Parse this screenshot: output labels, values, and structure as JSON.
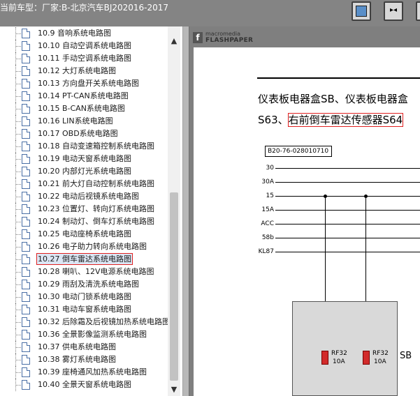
{
  "header": {
    "title": "当前车型：厂家:B-北京汽车BJ202016-2017",
    "buttons": [
      {
        "name": "toggle-panel",
        "glyph": "▪"
      },
      {
        "name": "fit-width",
        "glyph": "▸◂"
      },
      {
        "name": "fit-page",
        "glyph": "◂▸"
      }
    ]
  },
  "tree": {
    "items": [
      {
        "label": "10.9 音响系统电路图"
      },
      {
        "label": "10.10 自动空调系统电路图"
      },
      {
        "label": "10.11 手动空调系统电路图"
      },
      {
        "label": "10.12 大灯系统电路图"
      },
      {
        "label": "10.13 方向盘开关系统电路图"
      },
      {
        "label": "10.14 PT-CAN系统电路图"
      },
      {
        "label": "10.15 B-CAN系统电路图"
      },
      {
        "label": "10.16 LIN系统电路图"
      },
      {
        "label": "10.17 OBD系统电路图"
      },
      {
        "label": "10.18 自动变速箱控制系统电路图"
      },
      {
        "label": "10.19 电动天窗系统电路图"
      },
      {
        "label": "10.20 内部灯光系统电路图"
      },
      {
        "label": "10.21 前大灯自动控制系统电路图"
      },
      {
        "label": "10.22 电动后视镜系统电路图"
      },
      {
        "label": "10.23 位置灯、转向灯系统电路图"
      },
      {
        "label": "10.24 制动灯、倒车灯系统电路图"
      },
      {
        "label": "10.25 电动座椅系统电路图"
      },
      {
        "label": "10.26 电子助力转向系统电路图"
      },
      {
        "label": "10.27 倒车雷达系统电路图",
        "selected": true
      },
      {
        "label": "10.28 喇叭、12V电源系统电路图"
      },
      {
        "label": "10.29 雨刮及清洗系统电路图"
      },
      {
        "label": "10.30 电动门锁系统电路图"
      },
      {
        "label": "10.31 电动车窗系统电路图"
      },
      {
        "label": "10.32 后除霜及后视镜加热系统电路图"
      },
      {
        "label": "10.36 全景影像监测系统电路图"
      },
      {
        "label": "10.37 供电系统电路图"
      },
      {
        "label": "10.38 雾灯系统电路图"
      },
      {
        "label": "10.39 座椅通风加热系统电路图"
      },
      {
        "label": "10.40 全景天窗系统电路图"
      }
    ]
  },
  "viewer": {
    "logo_small": "macromedia",
    "logo_big": "FLASHPAPER",
    "heading_line1": "仪表板电器盒SB、仪表板电器盒",
    "heading_line2_prefix": "S63、",
    "heading_line2_boxed": "右前倒车雷达传感器S64",
    "code": "B20-76-028010710",
    "bus_labels": [
      "30",
      "30A",
      "15",
      "15A",
      "ACC",
      "58b",
      "KL87"
    ],
    "fuses": [
      {
        "label": "RF32",
        "rating": "10A"
      },
      {
        "label": "RF32",
        "rating": "10A"
      }
    ],
    "box_label": "SB"
  }
}
